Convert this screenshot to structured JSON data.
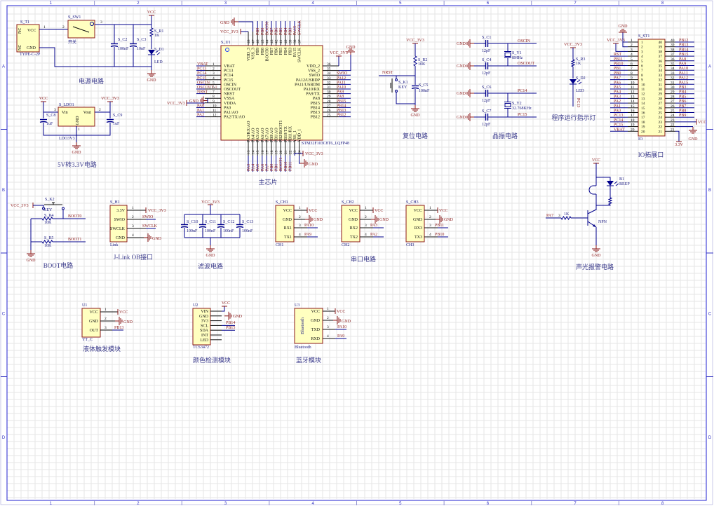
{
  "frame": {
    "cols": [
      "1",
      "2",
      "3",
      "4",
      "5",
      "6",
      "7",
      "8"
    ],
    "rows": [
      "A",
      "B",
      "C",
      "D"
    ]
  },
  "colors": {
    "wire": "#00008b",
    "power": "#8b1a1a",
    "body": "#ffffc0",
    "body_border": "#8b1a1a",
    "grid": "#e6e6e6",
    "border": "#2020d0"
  },
  "titles": {
    "power": "电源电路",
    "ldo": "5V转3.3V电路",
    "mcu": "主芯片",
    "reset": "复位电路",
    "crystal": "晶振电路",
    "led": "程序运行指示灯",
    "io": "IO拓展口",
    "boot": "BOOT电路",
    "jlink": "J-Link OB接口",
    "filter": "滤波电路",
    "uart": "串口电路",
    "alarm": "声光报警电路",
    "liquid": "液体触发模块",
    "color": "颜色检测模块",
    "bt": "蓝牙模块"
  },
  "nets": {
    "vcc": "VCC",
    "gnd": "GND",
    "v33": "VCC_3V3",
    "v33s": "3.3V"
  },
  "power": {
    "t1": "S_T1",
    "t1_part": "TYPE-C-2P",
    "t1_pins": [
      "VCC",
      "GND"
    ],
    "nc": "NC",
    "sw": "S_SW1",
    "sw_name": "开关",
    "pn1": "1",
    "pn2": "2",
    "pn3": "3",
    "c2": "S_C2",
    "c2v": "100nF",
    "c3": "S_C3",
    "c3v": "10nF",
    "r1": "S_R1",
    "r1v": "1K",
    "d1": "S_D1",
    "d1v": "LED"
  },
  "ldo": {
    "ref": "S_LDO1",
    "part": "LDO3V3",
    "pins": [
      "Vin",
      "Vout",
      "GND"
    ],
    "pn": [
      "3",
      "2",
      "1"
    ],
    "c8": "S_C8",
    "c9": "S_C9",
    "cv": "1uF"
  },
  "mcu": {
    "ref": "S_U1",
    "part": "STM32F103C8T6_LQFP48",
    "left_pins": [
      "VBAT",
      "PC13",
      "PC14",
      "PC15",
      "OSCIN",
      "OSCOUT",
      "NRST",
      "VSSA",
      "VDDA",
      "PA0",
      "PA1/AO",
      "PA2/TX/AO"
    ],
    "left_nums": [
      "1",
      "2",
      "3",
      "4",
      "5",
      "6",
      "7",
      "8",
      "9",
      "10",
      "11",
      "12"
    ],
    "left_nets": [
      "VBAT",
      "PC13",
      "PC14",
      "PC15",
      "OSCIN",
      "OSCOUT-1",
      "NRST",
      "",
      "",
      "PA0",
      "PA1",
      "PA2"
    ],
    "right_pins": [
      "VDD_2",
      "VSS_2",
      "SWIO",
      "PA12/USBDP",
      "PA11/USBDM",
      "PA10/RX",
      "PA9/TX",
      "PA8",
      "PB15",
      "PB14",
      "PB13",
      "PB12"
    ],
    "right_nums": [
      "36",
      "35",
      "34",
      "33",
      "32",
      "31",
      "30",
      "29",
      "28",
      "27",
      "26",
      "25"
    ],
    "right_nets": [
      "",
      "",
      "SWIO",
      "PA12",
      "PA11",
      "PA10",
      "PA9",
      "PA8",
      "PB15",
      "PB14",
      "PB13",
      "PB12"
    ],
    "top_pins": [
      "VDD_3",
      "VSS_3",
      "PB9",
      "PB8",
      "BOOT0",
      "PB7",
      "PB6",
      "PB5",
      "PB4",
      "PB3",
      "PA15",
      "SWCLK"
    ],
    "top_nums": [
      "48",
      "47",
      "46",
      "45",
      "44",
      "43",
      "42",
      "41",
      "40",
      "39",
      "38",
      "37"
    ],
    "top_nets": [
      "",
      "",
      "PB9",
      "PB8",
      "BOOT0",
      "PB7",
      "PB6",
      "PB5",
      "PB4",
      "PB3",
      "PA15",
      "SWCLK"
    ],
    "bottom_pins": [
      "PA3/RX/AO",
      "PA4/AO",
      "PA5/AO",
      "PA6/AO",
      "PA7/AO",
      "PB0/AO",
      "PB1/AO",
      "PB2/BOOT1",
      "PB10/TX",
      "PB11/RX",
      "VSS_1",
      "VDD_1"
    ],
    "bottom_nums": [
      "13",
      "14",
      "15",
      "16",
      "17",
      "18",
      "19",
      "20",
      "21",
      "22",
      "23",
      "24"
    ],
    "bottom_nets": [
      "PA3",
      "PA4",
      "PA5",
      "PA6",
      "PA7",
      "PB0",
      "PB1",
      "BOOT1",
      "PB10",
      "PB11",
      "",
      ""
    ]
  },
  "reset": {
    "net": "NRST",
    "r2": "S_R2",
    "r2v": "10K",
    "k1": "S_K1",
    "k1v": "KEY",
    "c5": "S_C5",
    "c5v": "100nF"
  },
  "crystal": {
    "caps": [
      "S_C1",
      "S_C4",
      "S_C6",
      "S_C7"
    ],
    "capv": "12pF",
    "nets": [
      "OSCIN",
      "OSCOUT",
      "PC14",
      "PC15"
    ],
    "y1": "S_Y1",
    "y1v": "8MHz",
    "y2": "S_Y2",
    "y2v": "32.768KHz"
  },
  "led": {
    "r3": "S_R3",
    "r3v": "1K",
    "d2": "S_D2",
    "d2v": "LED",
    "net": "PC13"
  },
  "io": {
    "ref": "S_ST1",
    "part": "IO",
    "left_nums": [
      "1",
      "2",
      "3",
      "4",
      "5",
      "6",
      "7",
      "8",
      "9",
      "10",
      "11",
      "12",
      "13",
      "14",
      "15",
      "16",
      "17",
      "18",
      "19",
      "20"
    ],
    "right_nums": [
      "40",
      "39",
      "38",
      "37",
      "36",
      "35",
      "34",
      "33",
      "32",
      "31",
      "30",
      "29",
      "28",
      "27",
      "26",
      "25",
      "24",
      "23",
      "22",
      "21"
    ],
    "left_nets": [
      "",
      "",
      "",
      "RST",
      "PB11",
      "PB10",
      "PB1",
      "PB0",
      "PA7",
      "PA6",
      "PA5",
      "PA4",
      "PA3",
      "PA2",
      "PA1",
      "PA0",
      "PC13",
      "PC14",
      "PC15",
      "VBAT"
    ],
    "right_nets": [
      "PB12",
      "PB13",
      "PB14",
      "PB15",
      "PA8",
      "PA9",
      "PA10",
      "PA11",
      "PA12",
      "PA15",
      "PB3",
      "PB4",
      "PB5",
      "PB6",
      "PB7",
      "PB8",
      "PB9",
      "",
      "",
      ""
    ]
  },
  "boot": {
    "k2": "S_K2",
    "k2v": "KEY",
    "r4": "S_R4",
    "r5": "S_R5",
    "rv": "10K",
    "net0": "BOOT0",
    "net1": "BOOT1"
  },
  "jlink": {
    "ref": "S_H1",
    "part": "Link",
    "pins": [
      "3.3V",
      "SWIO",
      "SWCLK",
      "GND"
    ],
    "nums": [
      "1",
      "2",
      "3",
      "4"
    ],
    "nets": [
      "SWIO",
      "SWCLK"
    ]
  },
  "filter": {
    "caps": [
      "S_C10",
      "S_C11",
      "S_C12",
      "S_C13"
    ],
    "capv": "100nF"
  },
  "uart": [
    {
      "ref": "S_CH1",
      "part": "CH1",
      "pins": [
        "VCC",
        "GND",
        "RX1",
        "TX1"
      ],
      "nets": [
        "PA10",
        "PA9"
      ]
    },
    {
      "ref": "S_CH2",
      "part": "CH2",
      "pins": [
        "VCC",
        "GND",
        "RX2",
        "TX2"
      ],
      "nets": [
        "PA3",
        "PA2"
      ]
    },
    {
      "ref": "S_CH3",
      "part": "CH3",
      "pins": [
        "VCC",
        "GND",
        "RX3",
        "TX3"
      ],
      "nets": [
        "PB11",
        "PB10"
      ]
    }
  ],
  "uart_nums": [
    "1",
    "2",
    "3",
    "4"
  ],
  "alarm": {
    "net": "PA7",
    "pn": "3",
    "r": "1K",
    "q": "NPN",
    "b1": "B1",
    "b1v": "BEEP"
  },
  "liquid": {
    "ref": "U1",
    "part": "YT_C",
    "pins": [
      "VCC",
      "GND",
      "OUT"
    ],
    "net": "PB13"
  },
  "color": {
    "ref": "U2",
    "part": "TCS3472",
    "pins": [
      "VIN",
      "GND",
      "3V3",
      "SCL",
      "SDA",
      "INT",
      "LED"
    ],
    "nets": [
      "PB14",
      "PB15"
    ]
  },
  "bt": {
    "ref": "U3",
    "part": "Bluetooth",
    "inner": "Bluetooth",
    "pins": [
      "VCC",
      "GND",
      "TXD",
      "RXD"
    ],
    "nets": [
      "PA10",
      "PA9"
    ]
  }
}
